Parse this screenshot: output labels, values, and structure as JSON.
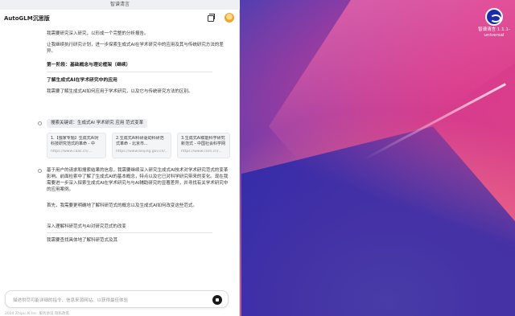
{
  "window_title": "智谱清言",
  "desktop_icon": {
    "label": "智谱清言 1.1.1-universal"
  },
  "header": {
    "title": "AutoGLM沉思版",
    "chevron": "⌄"
  },
  "messages": [
    "我需要研究深入研究，以形成一个完整的分析报告。",
    "让我继续执行研究计划，进一步探索生成式AI在学术研究中的应用及其与传统研究方法的差异。",
    "第一阶段：基础概念与理论框架（继续）",
    "了解生成式AI在学术研究中的应用",
    "我需要了解生成式AI如何应用于学术研究，以及它与传统研究方法的区别。"
  ],
  "search_chip": "搜索关键词：生成式AI 学术研究 应用 范式变革",
  "cards": [
    {
      "title": "1.【独家专题】生成式AI对科技研究范式的革命 - 中国...",
      "url": "https://www.caas.cn/..."
    },
    {
      "title": "2.生成式AI科研驱动科研范式革命 - 北京市...",
      "url": "https://www.beijing.gov.cn/..."
    },
    {
      "title": "3.生成式AI赋能科学研究新范式 - 中国社会科学网",
      "url": "https://www.cssn.cn/..."
    }
  ],
  "paragraphs": [
    "基于用户的请求和搜索结果的信息，我需要继续深入研究生成式AI技术对学术研究范式的变革影响。前面检索中了解了生成式AI的基本概念，特点以及它已对科学研究带来的变化。现在我需要进一步深入探索生成式AI在学术研究与与AI辅助研究的显著差异，并寻找有关学术研究中的应用案例。",
    "首先，我需要更明确地了解科研范式的概念以及生成式AI如何改变这些范式。"
  ],
  "subheading": "深入理解科研范式与AI对研究范式的改变",
  "final_text": "我需要查找具体地了解科研范式及其",
  "input": {
    "placeholder": "描述供尽可能详细的指令、信息来源网站、以获得最佳体验"
  },
  "footer_text": "2024 Zhipu AI Inc. 服务协议 隐私政策"
}
